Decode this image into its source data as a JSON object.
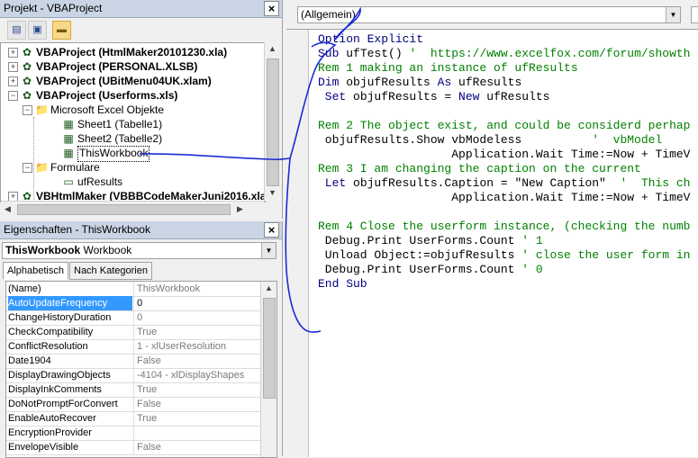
{
  "project": {
    "title": "Projekt - VBAProject",
    "close": "×",
    "nodes": [
      {
        "label": "VBAProject (HtmlMaker20101230.xla)",
        "bold": true,
        "expander": "+"
      },
      {
        "label": "VBAProject (PERSONAL.XLSB)",
        "bold": true,
        "expander": "+"
      },
      {
        "label": "VBAProject (UBitMenu04UK.xlam)",
        "bold": true,
        "expander": "+"
      },
      {
        "label": "VBAProject (Userforms.xls)",
        "bold": true,
        "expander": "−"
      },
      {
        "label": "Microsoft Excel Objekte",
        "bold": false,
        "expander": "−"
      },
      {
        "label": "Sheet1 (Tabelle1)",
        "bold": false,
        "expander": ""
      },
      {
        "label": "Sheet2 (Tabelle2)",
        "bold": false,
        "expander": ""
      },
      {
        "label": "ThisWorkbook",
        "bold": false,
        "expander": ""
      },
      {
        "label": "Formulare",
        "bold": false,
        "expander": "−"
      },
      {
        "label": "ufResults",
        "bold": false,
        "expander": ""
      },
      {
        "label": "VBHtmlMaker (VBBBCodeMakerJuni2016.xla",
        "bold": true,
        "expander": "+"
      }
    ]
  },
  "properties": {
    "title": "Eigenschaften - ThisWorkbook",
    "object_name": "ThisWorkbook",
    "object_type": "Workbook",
    "tabs": [
      "Alphabetisch",
      "Nach Kategorien"
    ],
    "rows": [
      {
        "name": "(Name)",
        "value": "ThisWorkbook"
      },
      {
        "name": "AutoUpdateFrequency",
        "value": "0"
      },
      {
        "name": "ChangeHistoryDuration",
        "value": "0"
      },
      {
        "name": "CheckCompatibility",
        "value": "True"
      },
      {
        "name": "ConflictResolution",
        "value": "1 - xlUserResolution"
      },
      {
        "name": "Date1904",
        "value": "False"
      },
      {
        "name": "DisplayDrawingObjects",
        "value": "-4104 - xlDisplayShapes"
      },
      {
        "name": "DisplayInkComments",
        "value": "True"
      },
      {
        "name": "DoNotPromptForConvert",
        "value": "False"
      },
      {
        "name": "EnableAutoRecover",
        "value": "True"
      },
      {
        "name": "EncryptionProvider",
        "value": ""
      },
      {
        "name": "EnvelopeVisible",
        "value": "False"
      }
    ],
    "selected_row": "AutoUpdateFrequency"
  },
  "code": {
    "object_combo": "(Allgemein)",
    "lines": [
      [
        [
          "kw",
          "Option Explicit"
        ]
      ],
      [
        [
          "kw",
          "Sub "
        ],
        [
          "tx",
          "ufTest() "
        ],
        [
          "cm",
          "'  https://www.excelfox.com/forum/showth"
        ]
      ],
      [
        [
          "cm",
          "Rem 1 making an instance of ufResults"
        ]
      ],
      [
        [
          "kw",
          "Dim "
        ],
        [
          "tx",
          "objufResults "
        ],
        [
          "kw",
          "As "
        ],
        [
          "tx",
          "ufResults"
        ]
      ],
      [
        [
          "kw",
          " Set "
        ],
        [
          "tx",
          "objufResults = "
        ],
        [
          "kw",
          "New "
        ],
        [
          "tx",
          "ufResults"
        ]
      ],
      [
        [
          "tx",
          ""
        ]
      ],
      [
        [
          "cm",
          "Rem 2 The object exist, and could be considerd perhap"
        ]
      ],
      [
        [
          "tx",
          " objufResults.Show vbModeless          "
        ],
        [
          "cm",
          "'  vbModel"
        ]
      ],
      [
        [
          "tx",
          "                   Application.Wait Time:=Now + TimeV"
        ]
      ],
      [
        [
          "cm",
          "Rem 3 I am changing the caption on the current"
        ]
      ],
      [
        [
          "kw",
          " Let "
        ],
        [
          "tx",
          "objufResults.Caption = \"New Caption\"  "
        ],
        [
          "cm",
          "'  This ch"
        ]
      ],
      [
        [
          "tx",
          "                   Application.Wait Time:=Now + TimeV"
        ]
      ],
      [
        [
          "tx",
          ""
        ]
      ],
      [
        [
          "cm",
          "Rem 4 Close the userform instance, (checking the numb"
        ]
      ],
      [
        [
          "tx",
          " Debug.Print UserForms.Count "
        ],
        [
          "cm",
          "' 1"
        ]
      ],
      [
        [
          "tx",
          " Unload Object:=objufResults "
        ],
        [
          "cm",
          "' close the user form in"
        ]
      ],
      [
        [
          "tx",
          " Debug.Print UserForms.Count "
        ],
        [
          "cm",
          "' 0"
        ]
      ],
      [
        [
          "kw",
          "End Sub"
        ]
      ]
    ]
  },
  "colors": {
    "keyword": "#00007f",
    "comment": "#008000",
    "selection": "#3399ff",
    "annotation": "#1c2bd4"
  }
}
